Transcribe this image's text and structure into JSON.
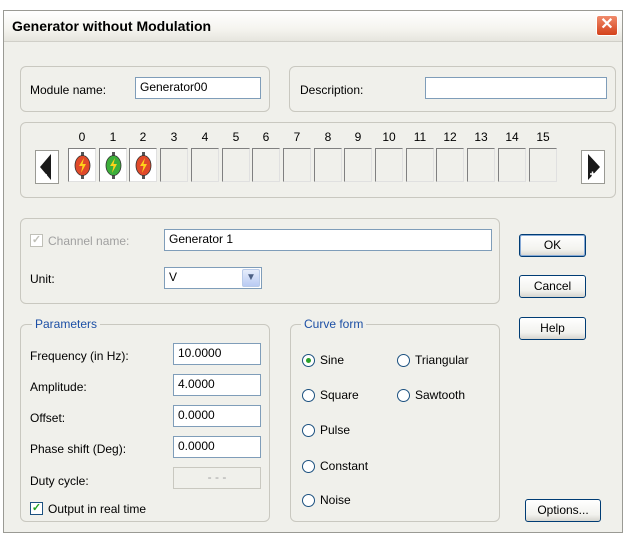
{
  "window": {
    "title": "Generator without Modulation",
    "close_glyph": "✕"
  },
  "module": {
    "name_label": "Module name:",
    "name_value": "Generator00",
    "description_label": "Description:",
    "description_value": ""
  },
  "channels": {
    "labels": [
      "0",
      "1",
      "2",
      "3",
      "4",
      "5",
      "6",
      "7",
      "8",
      "9",
      "10",
      "11",
      "12",
      "13",
      "14",
      "15"
    ],
    "active_slots": [
      {
        "index": 0,
        "color": "#e04a2a"
      },
      {
        "index": 1,
        "color": "#3cae3a"
      },
      {
        "index": 2,
        "color": "#e04a2a"
      }
    ],
    "prev_icon": "arrow-left-minus-icon",
    "next_icon": "arrow-right-plus-icon"
  },
  "channel": {
    "name_label": "Channel name:",
    "name_value": "Generator 1",
    "unit_label": "Unit:",
    "unit_value": "V",
    "dropdown_glyph": "▼"
  },
  "buttons": {
    "ok": "OK",
    "cancel": "Cancel",
    "help": "Help",
    "options": "Options..."
  },
  "parameters": {
    "title": "Parameters",
    "frequency_label": "Frequency (in Hz):",
    "frequency_value": "10.0000",
    "amplitude_label": "Amplitude:",
    "amplitude_value": "4.0000",
    "offset_label": "Offset:",
    "offset_value": "0.0000",
    "phase_label": "Phase shift (Deg):",
    "phase_value": "0.0000",
    "duty_label": "Duty cycle:",
    "duty_value": "- - -",
    "realtime_label": "Output in real time",
    "check_glyph": "✓"
  },
  "curve": {
    "title": "Curve form",
    "sine": "Sine",
    "triangular": "Triangular",
    "square": "Square",
    "sawtooth": "Sawtooth",
    "pulse": "Pulse",
    "constant": "Constant",
    "noise": "Noise",
    "selected": "Sine"
  }
}
